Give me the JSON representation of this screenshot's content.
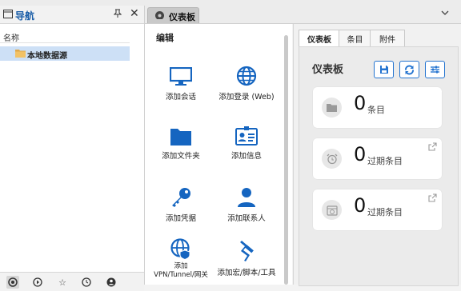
{
  "nav": {
    "title": "导航",
    "column_header": "名称",
    "tree_item": "本地数据源"
  },
  "tab": {
    "label": "仪表板"
  },
  "edit": {
    "title": "编辑",
    "tiles": [
      {
        "label": "添加会话"
      },
      {
        "label": "添加登录 (Web)"
      },
      {
        "label": "添加文件夹"
      },
      {
        "label": "添加信息"
      },
      {
        "label": "添加凭据"
      },
      {
        "label": "添加联系人"
      },
      {
        "label": "添加\nVPN/Tunnel/网关"
      },
      {
        "label": "添加宏/脚本/工具"
      }
    ]
  },
  "right": {
    "tabs": [
      "仪表板",
      "条目",
      "附件"
    ],
    "title": "仪表板",
    "cards": [
      {
        "count": "0",
        "label": "条目"
      },
      {
        "count": "0",
        "label": "过期条目"
      },
      {
        "count": "0",
        "label": "过期条目"
      }
    ]
  },
  "colors": {
    "accent": "#1b5ea8",
    "icon_blue": "#1565c0",
    "selection": "#cde0f6"
  }
}
